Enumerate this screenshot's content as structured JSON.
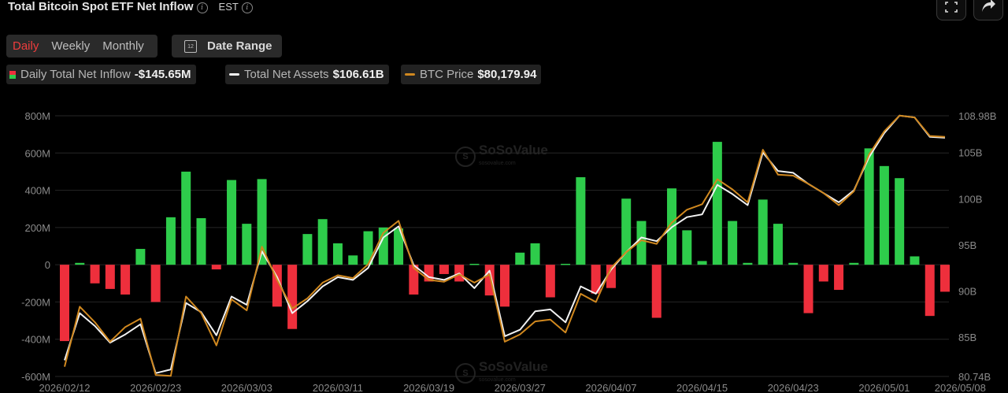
{
  "header": {
    "title": "Total Bitcoin Spot ETF Net Inflow",
    "timezone": "EST"
  },
  "toolbar": {
    "periods": [
      "Daily",
      "Weekly",
      "Monthly"
    ],
    "active_period": "Daily",
    "date_range_label": "Date Range",
    "calendar_day": "12"
  },
  "legend": {
    "inflow": {
      "name": "Daily Total Net Inflow",
      "value": "-$145.65M"
    },
    "assets": {
      "name": "Total Net Assets",
      "value": "$106.61B"
    },
    "price": {
      "name": "BTC Price",
      "value": "$80,179.94"
    }
  },
  "watermark": {
    "brand": "SoSoValue",
    "sub": "sosovalue.com"
  },
  "colors": {
    "positive": "#2ecc4b",
    "negative": "#ee2f3c",
    "assets": "#f2f2f2",
    "price": "#d0881f",
    "grid": "#262626",
    "axis_text": "#8a8a8a",
    "active": "#ee3d3d"
  },
  "chart_data": {
    "type": "bar",
    "ylim": [
      -600,
      800
    ],
    "y_ticks": [
      "800M",
      "600M",
      "400M",
      "200M",
      "0",
      "-200M",
      "-400M",
      "-600M"
    ],
    "y2lim": [
      80.74,
      108.98
    ],
    "y2_ticks": [
      {
        "v": 108.98,
        "label": "108.98B"
      },
      {
        "v": 105,
        "label": "105B"
      },
      {
        "v": 100,
        "label": "100B"
      },
      {
        "v": 95,
        "label": "95B"
      },
      {
        "v": 90,
        "label": "90B"
      },
      {
        "v": 85,
        "label": "85B"
      },
      {
        "v": 80.74,
        "label": "80.74B"
      }
    ],
    "x_tick_labels": [
      {
        "i": 0,
        "label": "2026/02/12"
      },
      {
        "i": 6,
        "label": "2026/02/23"
      },
      {
        "i": 12,
        "label": "2026/03/03"
      },
      {
        "i": 18,
        "label": "2026/03/11"
      },
      {
        "i": 24,
        "label": "2026/03/19"
      },
      {
        "i": 30,
        "label": "2026/03/27"
      },
      {
        "i": 36,
        "label": "2026/04/07"
      },
      {
        "i": 42,
        "label": "2026/04/15"
      },
      {
        "i": 48,
        "label": "2026/04/23"
      },
      {
        "i": 54,
        "label": "2026/05/01"
      },
      {
        "i": 59,
        "label": "2026/05/08"
      }
    ],
    "series": [
      {
        "name": "Daily Total Net Inflow",
        "values": [
          -410,
          10,
          -100,
          -130,
          -160,
          85,
          -200,
          255,
          500,
          250,
          -25,
          455,
          220,
          460,
          -225,
          -345,
          165,
          245,
          115,
          50,
          180,
          200,
          195,
          -160,
          -90,
          -50,
          -90,
          5,
          -165,
          -225,
          65,
          115,
          -175,
          5,
          470,
          -155,
          -125,
          355,
          235,
          -285,
          410,
          185,
          20,
          660,
          235,
          10,
          350,
          220,
          10,
          -260,
          -90,
          -135,
          10,
          625,
          530,
          465,
          45,
          -275,
          -145
        ]
      },
      {
        "name": "Total Net Assets",
        "values": [
          82.5,
          87.6,
          86.2,
          84.4,
          85.3,
          86.4,
          81.1,
          81.5,
          88.7,
          87.7,
          85.2,
          89.4,
          88.5,
          94.3,
          91.5,
          87.6,
          88.9,
          90.5,
          91.5,
          91.2,
          92.5,
          95.8,
          97.0,
          92.8,
          91.5,
          91.2,
          91.9,
          90.3,
          92.2,
          85.1,
          85.8,
          87.8,
          88.0,
          86.6,
          90.5,
          89.7,
          92.3,
          94.2,
          95.8,
          95.4,
          96.9,
          98.0,
          98.3,
          101.5,
          100.5,
          99.3,
          105.0,
          103.0,
          102.8,
          101.6,
          100.6,
          99.6,
          100.9,
          104.5,
          107.1,
          109.0,
          108.8,
          106.7,
          106.6
        ]
      },
      {
        "name": "BTC Price",
        "values": [
          81.8,
          88.3,
          86.6,
          84.5,
          86.1,
          87.0,
          80.9,
          80.8,
          89.4,
          87.6,
          84.1,
          89.1,
          87.9,
          94.8,
          91.2,
          88.1,
          89.2,
          90.9,
          91.7,
          91.4,
          92.9,
          96.3,
          97.6,
          92.5,
          91.2,
          91.0,
          91.8,
          90.9,
          91.8,
          84.5,
          85.3,
          86.7,
          86.9,
          85.5,
          89.7,
          88.8,
          92.5,
          94.2,
          95.5,
          95.1,
          97.4,
          98.8,
          99.4,
          102.1,
          101.0,
          99.6,
          105.3,
          102.6,
          102.5,
          101.6,
          100.6,
          99.3,
          100.8,
          104.8,
          107.3,
          109.0,
          108.8,
          106.8,
          106.7
        ]
      }
    ]
  }
}
